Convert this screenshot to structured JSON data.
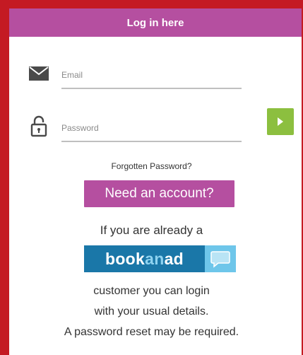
{
  "header": {
    "title": "Log in here"
  },
  "form": {
    "email_placeholder": "Email",
    "password_placeholder": "Password",
    "forgot_label": "Forgotten Password?"
  },
  "cta": {
    "need_account_label": "Need an account?"
  },
  "info": {
    "already": "If you are already a",
    "logo_text_1": "book",
    "logo_text_2": "an",
    "logo_text_3": "ad",
    "line1": "customer you can login",
    "line2": "with your usual details.",
    "line3": "A password reset may be required."
  },
  "colors": {
    "frame": "#c41a23",
    "brand_purple": "#b54fa0",
    "submit_green": "#8cbf3f",
    "logo_blue": "#1a77a8",
    "logo_light_blue": "#6ec6ea"
  },
  "icons": {
    "email": "envelope-icon",
    "password": "padlock-icon",
    "submit": "play-arrow-icon",
    "logo": "speech-bubble-icon"
  }
}
